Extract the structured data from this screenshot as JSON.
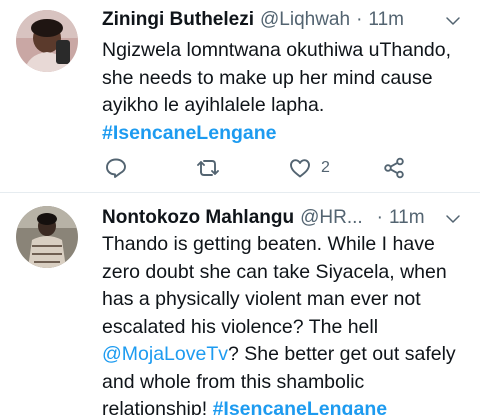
{
  "tweets": [
    {
      "name": "Ziningi Buthelezi",
      "handle": "@Liqhwah",
      "separator": "·",
      "time": "11m",
      "lines": [
        "Ngizwela lomntwana okuthiwa uThando,",
        "she needs to make up her mind cause",
        "ayikho le ayihlalele lapha."
      ],
      "hashtag": "#IsencaneLengane",
      "likes": "2",
      "icons": [
        "reply-icon",
        "retweet-icon",
        "like-icon",
        "share-icon",
        "chevron-down-icon"
      ]
    },
    {
      "name": "Nontokozo Mahlangu",
      "handle": "@HR...",
      "separator": "·",
      "time": "11m",
      "lines": [
        "Thando is getting beaten. While I have",
        "zero doubt she can take Siyacela, when",
        "has a physically violent man ever not",
        "escalated his violence? The hell"
      ],
      "mention": "@MojaLoveTv",
      "line5_rest": "? She better get out safely",
      "line6": "and whole from this shambolic",
      "line7_text": "relationship! ",
      "hashtag": "#IsencaneLengane",
      "icons": [
        "chevron-down-icon"
      ]
    }
  ],
  "colors": {
    "link": "#1d9bf0",
    "secondary": "#536471",
    "text": "#0f1419",
    "divider": "#e6ecf0"
  }
}
